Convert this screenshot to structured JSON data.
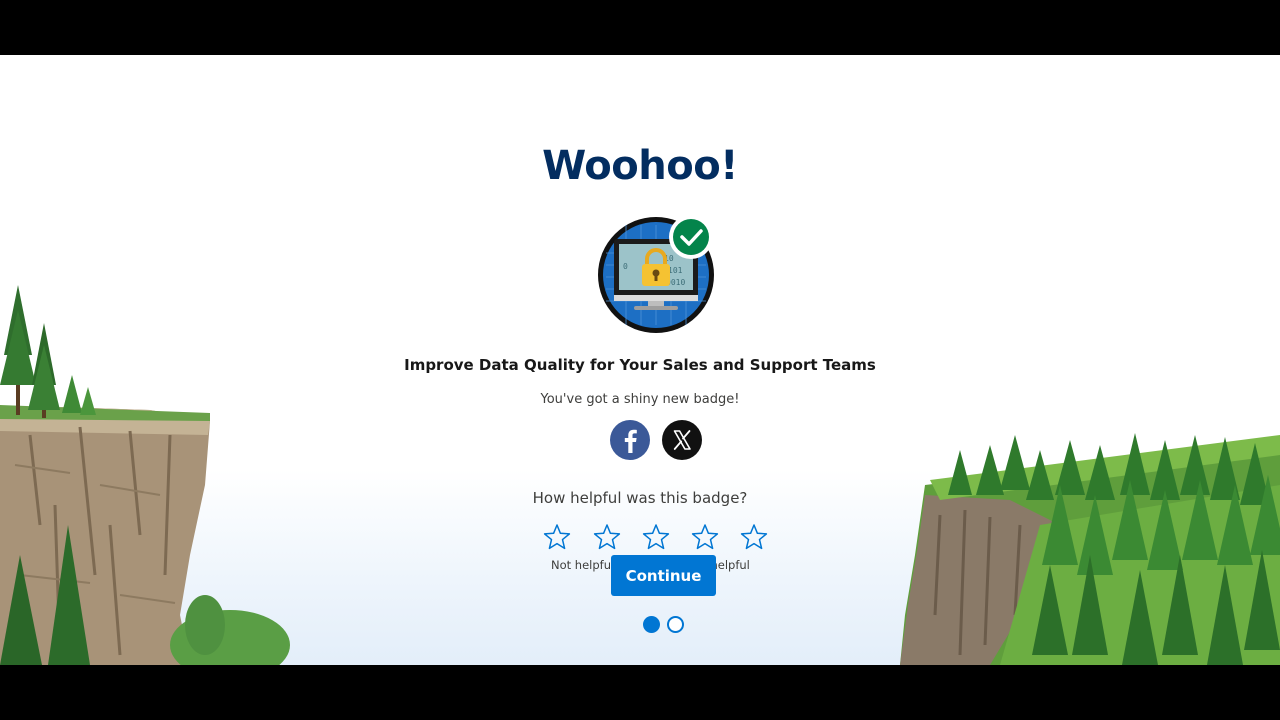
{
  "page": {
    "title": "Woohoo!",
    "badge_name": "Improve Data Quality for Your Sales and Support Teams",
    "subtitle": "You've got a shiny new badge!"
  },
  "share": {
    "facebook_icon": "facebook-icon",
    "x_icon": "x-icon"
  },
  "rating": {
    "question": "How helpful was this badge?",
    "stars": 5,
    "low_label": "Not helpful",
    "high_label": "y helpful"
  },
  "actions": {
    "continue_label": "Continue"
  },
  "pagination": {
    "total": 2,
    "current": 1
  },
  "colors": {
    "title": "#032d60",
    "primary": "#0176d3",
    "success": "#04844b",
    "facebook": "#3b5998"
  }
}
